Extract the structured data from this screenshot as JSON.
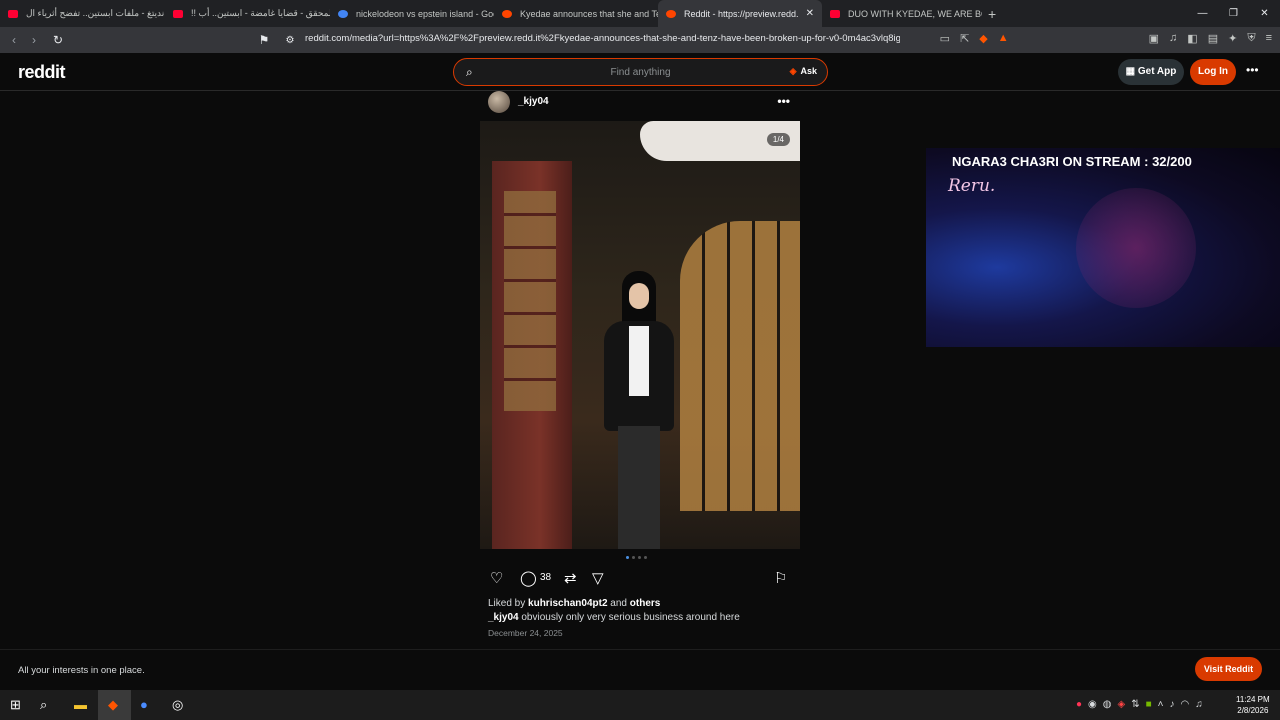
{
  "browser": {
    "tabs": [
      {
        "label": "ترانديتغ - ملفات ابستين.. تفضح أثرياء ال",
        "fav_color": "#ff0033"
      },
      {
        "label": "!! المحقق - قضايا غامضة - ابستين.. أب",
        "fav_color": "#ff0033"
      },
      {
        "label": "nickelodeon vs epstein island - Goog",
        "fav_color": "#4285f4"
      },
      {
        "label": "Kyedae announces that she and Tenz",
        "fav_color": "#ff4500"
      },
      {
        "label": "Reddit - https://preview.redd.it/i",
        "fav_color": "#ff4500"
      },
      {
        "label": "DUO WITH KYEDAE, WE ARE BOTH V",
        "fav_color": "#ff0033"
      }
    ],
    "close_tab": "✕",
    "new_tab": "+",
    "window_controls": {
      "minimize": "—",
      "restore": "❐",
      "close": "✕"
    },
    "url": "reddit.com/media?url=https%3A%2F%2Fpreview.redd.it%2Fkyedae-announces-that-she-and-tenz-have-been-broken-up-for-v0-0m4ac3vlq8ig..."
  },
  "header": {
    "logo": "reddit",
    "search_placeholder": "Find anything",
    "ask_label": "Ask",
    "get_app": "Get App",
    "login": "Log In"
  },
  "post": {
    "username": "_kjy04",
    "image_counter": "1/4",
    "comment_count": "38",
    "liked_prefix": "Liked by ",
    "liked_user": "kuhrischan04pt2",
    "liked_mid": " and ",
    "liked_others": "others",
    "caption_user": "_kjy04",
    "caption_text": " obviously only very serious business around here",
    "date": "December 24, 2025"
  },
  "stream": {
    "title": "NGARA3 CHA3RI ON STREAM : 32/200",
    "sign": "Reru."
  },
  "banner": {
    "text": "All your interests in one place.",
    "visit": "Visit Reddit"
  },
  "taskbar": {
    "time": "11:24 PM",
    "date": "2/8/2026"
  }
}
